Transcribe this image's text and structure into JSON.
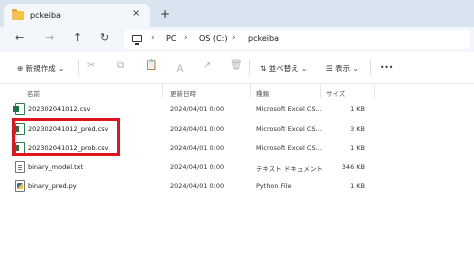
{
  "tab": {
    "title": "pckeiba",
    "close": "×",
    "new": "+"
  },
  "nav": {
    "back": "←",
    "forward": "→",
    "up": "↑",
    "refresh": "↻"
  },
  "breadcrumb": {
    "sep": "›",
    "items": [
      "PC",
      "OS (C:)",
      "pckeiba"
    ]
  },
  "toolbar": {
    "new_label": "⊕ 新規作成 ⌄",
    "cut": "✂",
    "copy": "⧉",
    "paste": "📋",
    "rename": "Ａ",
    "share": "↗",
    "delete": "🗑",
    "sort_label": "⇅ 並べ替え ⌄",
    "view_label": "☰ 表示 ⌄",
    "more": "•••"
  },
  "columns": {
    "name": "名前",
    "modified": "更新日時",
    "type": "種類",
    "size": "サイズ"
  },
  "files": [
    {
      "name": "202302041012.csv",
      "modified": "2024/04/01 0:00",
      "type": "Microsoft Excel CS...",
      "size": "1 KB",
      "icon": "excel-icon"
    },
    {
      "name": "202302041012_pred.csv",
      "modified": "2024/04/01 0:00",
      "type": "Microsoft Excel CS...",
      "size": "3 KB",
      "icon": "excel-icon"
    },
    {
      "name": "202302041012_prob.csv",
      "modified": "2024/04/01 0:00",
      "type": "Microsoft Excel CS...",
      "size": "1 KB",
      "icon": "excel-icon"
    },
    {
      "name": "binary_model.txt",
      "modified": "2024/04/01 0:00",
      "type": "テキスト ドキュメント",
      "size": "346 KB",
      "icon": "text-file-icon"
    },
    {
      "name": "binary_pred.py",
      "modified": "2024/04/01 0:00",
      "type": "Python File",
      "size": "1 KB",
      "icon": "python-file-icon"
    }
  ],
  "colors": {
    "highlight": "#e0141e",
    "tab_strip": "#d9e4f1",
    "excel": "#1f7244"
  }
}
